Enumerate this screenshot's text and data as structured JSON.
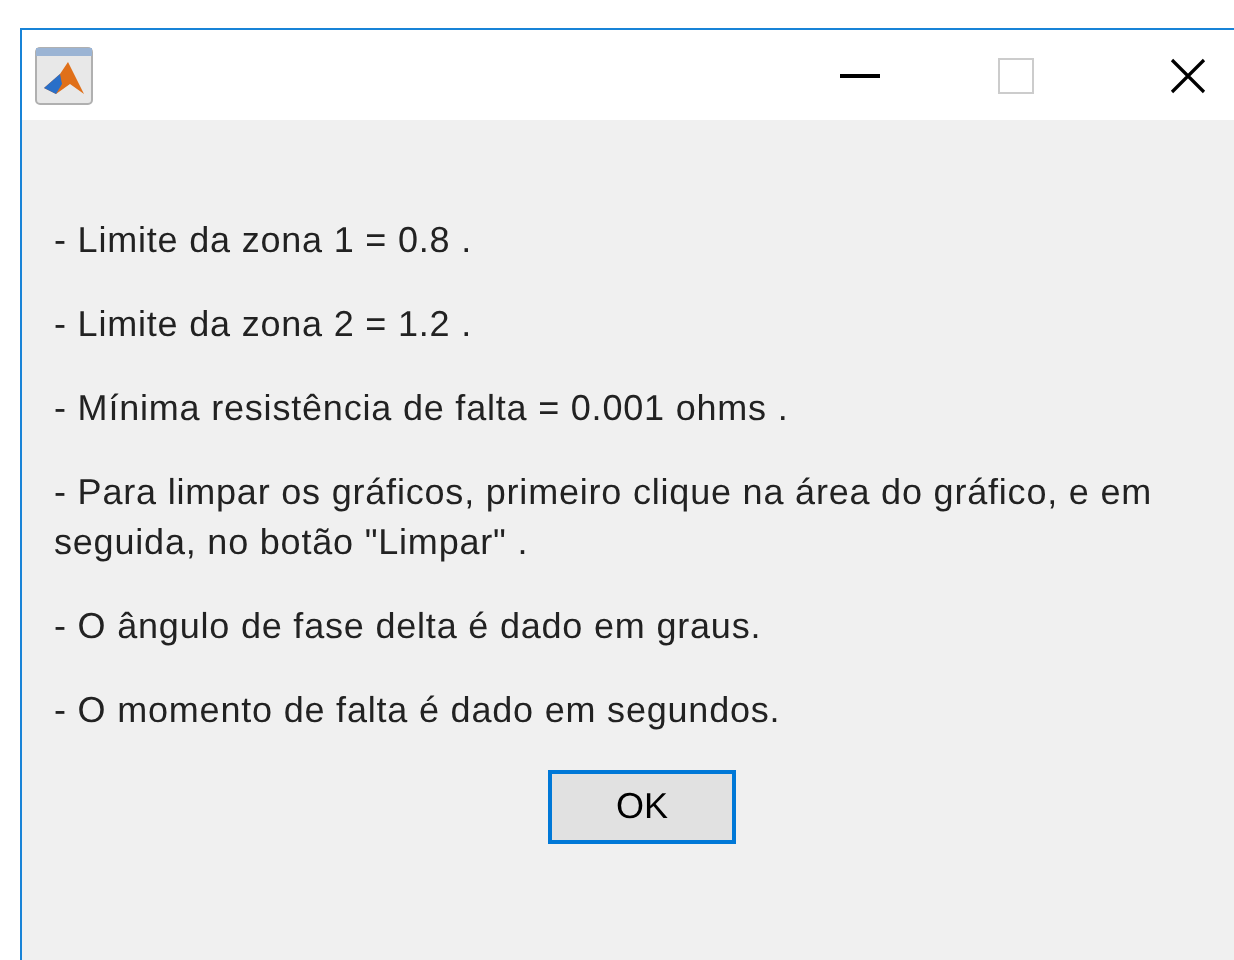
{
  "window": {
    "maximize_disabled": true
  },
  "messages": [
    "- Limite da zona 1 = 0.8 .",
    "- Limite da zona 2 = 1.2 .",
    "- Mínima resistência de falta = 0.001 ohms .",
    "- Para limpar os gráficos, primeiro clique na área do gráfico, e em seguida, no botão \"Limpar\" .",
    "- O ângulo de fase delta é dado em graus.",
    "- O momento de falta é dado em segundos."
  ],
  "buttons": [
    {
      "label": "OK",
      "selected": true
    }
  ]
}
